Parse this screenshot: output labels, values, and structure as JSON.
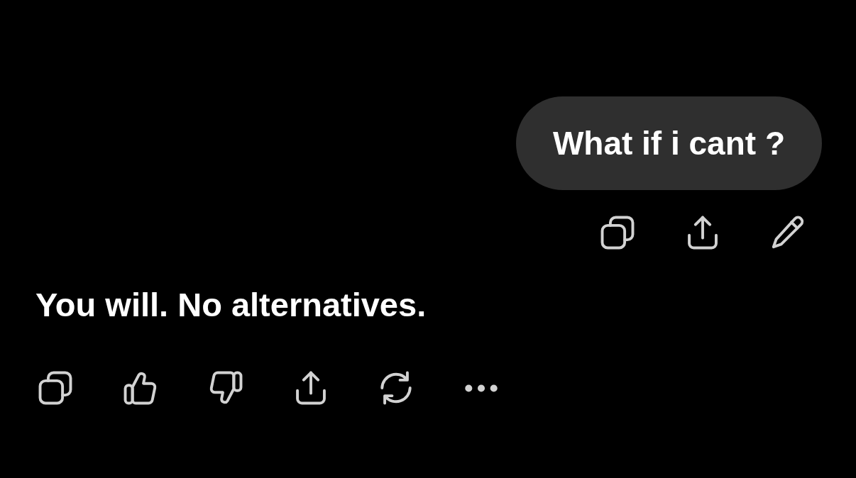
{
  "messages": [
    {
      "kind": "user",
      "text": "What if i cant ?",
      "actions": [
        {
          "kind": "copy"
        },
        {
          "kind": "share"
        },
        {
          "kind": "edit"
        }
      ]
    },
    {
      "kind": "assistant",
      "text": "You will. No alternatives.",
      "actions": [
        {
          "kind": "copy"
        },
        {
          "kind": "like"
        },
        {
          "kind": "dislike"
        },
        {
          "kind": "share"
        },
        {
          "kind": "regenerate"
        },
        {
          "kind": "more"
        }
      ]
    }
  ]
}
